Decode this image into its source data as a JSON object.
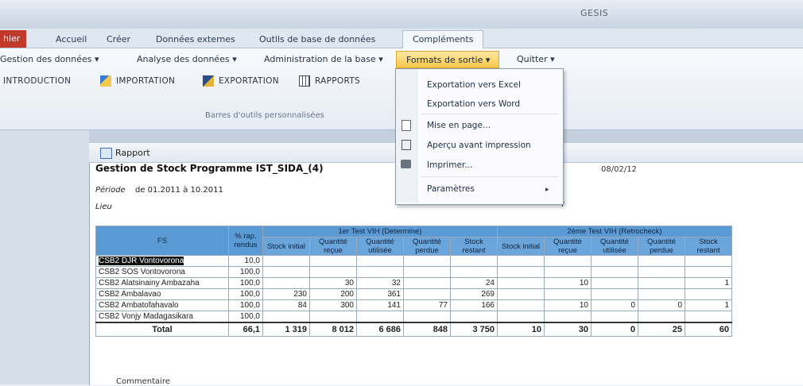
{
  "window": {
    "title": "GESIS"
  },
  "tabs": {
    "fichier": "hier",
    "accueil": "Accueil",
    "creer": "Créer",
    "donnees": "Données externes",
    "outils": "Outils de base de données",
    "complements": "Compléments"
  },
  "menu": {
    "gestion": "Gestion des données ▾",
    "analyse": "Analyse des données ▾",
    "admin": "Administration de la base ▾",
    "formats": "Formats de sortie ▾",
    "quitter": "Quitter ▾"
  },
  "toolbar": {
    "intro": "INTRODUCTION",
    "import": "IMPORTATION",
    "export": "EXPORTATION",
    "rapports": "RAPPORTS",
    "group_label": "Barres d'outils personnalisées"
  },
  "dropdown": {
    "items": [
      "Exportation vers Excel",
      "Exportation vers Word",
      "Mise en page...",
      "Aperçu avant impression",
      "Imprimer...",
      "Paramètres"
    ],
    "arrow": "▸"
  },
  "report": {
    "tab_label": "Rapport",
    "title": "Gestion de Stock Programme IST_SIDA_(4)",
    "date": "08/02/12",
    "periode_label": "Période",
    "periode_value": "de 01.2011 à 10.2011",
    "lieu_label": "Lieu",
    "partial_r": "r",
    "commentaire": "Commentaire"
  },
  "table": {
    "h_fs": "FS",
    "h_rap": "% rap. rendus",
    "group1": "1er Test VIH (Determine)",
    "group2": "2ème Test VIH (Retrocheck)",
    "sub1": [
      "Stock initial",
      "Quantité reçue",
      "Quantité utilisée",
      "Quantité perdue",
      "Stock restant"
    ],
    "sub2": [
      "Stock initial",
      "Quantité reçue",
      "Quantité utilisée",
      "Quantité perdue",
      "Stock restant"
    ],
    "rows": [
      [
        "CSB2 DJR Vontovorona",
        "10,0",
        "",
        "",
        "",
        "",
        "",
        "",
        "",
        "",
        "",
        ""
      ],
      [
        "CSB2 SOS Vontovorona",
        "100,0",
        "",
        "",
        "",
        "",
        "",
        "",
        "",
        "",
        "",
        ""
      ],
      [
        "CSB2 Alatsinainy Ambazaha",
        "100,0",
        "",
        "30",
        "32",
        "",
        "24",
        "",
        "10",
        "",
        "",
        "1"
      ],
      [
        "CSB2 Ambalavao",
        "100,0",
        "230",
        "200",
        "361",
        "",
        "269",
        "",
        "",
        "",
        "",
        ""
      ],
      [
        "CSB2 Ambatofahavalo",
        "100,0",
        "84",
        "300",
        "141",
        "77",
        "166",
        "",
        "10",
        "0",
        "0",
        "1"
      ],
      [
        "CSB2 Vonjy Madagasikara",
        "100,0",
        "",
        "",
        "",
        "",
        "",
        "",
        "",
        "",
        "",
        ""
      ]
    ],
    "total": [
      "Total",
      "66,1",
      "1 319",
      "8 012",
      "6 686",
      "848",
      "3 750",
      "10",
      "30",
      "0",
      "25",
      "60"
    ]
  },
  "colors": {
    "accent": "#f7c84a",
    "header_blue": "#5b9bd5",
    "fichier_red": "#c0392b"
  }
}
